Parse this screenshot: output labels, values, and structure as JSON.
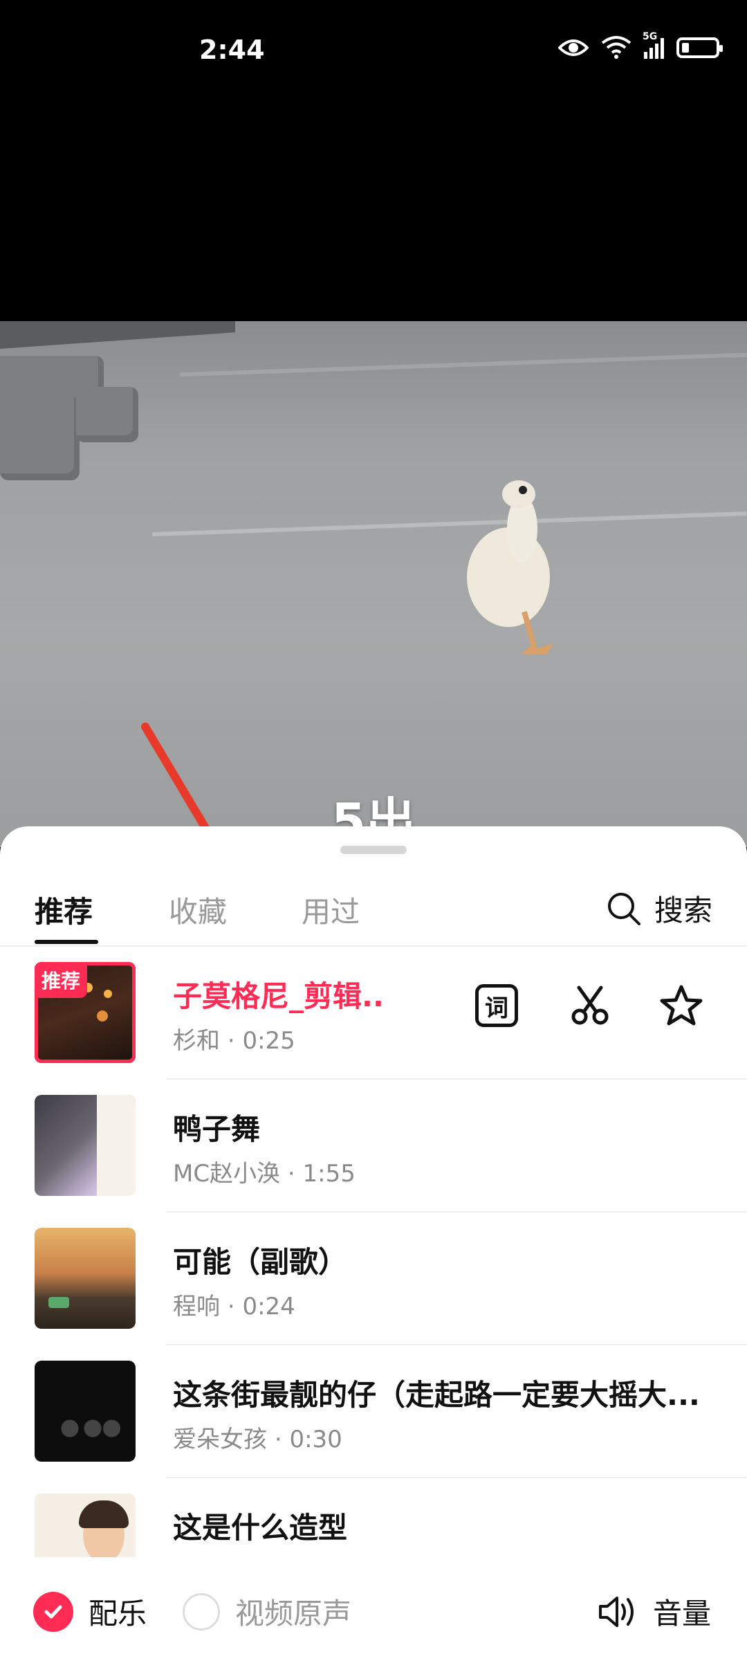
{
  "status_bar": {
    "time": "2:44",
    "network": "5G"
  },
  "video": {
    "caption": "5出"
  },
  "tabs": [
    {
      "label": "推荐"
    },
    {
      "label": "收藏"
    },
    {
      "label": "用过"
    }
  ],
  "search": {
    "label": "搜索"
  },
  "songs": [
    {
      "badge": "推荐",
      "title": "子莫格尼_剪辑..",
      "artist": "杉和",
      "duration": "0:25"
    },
    {
      "title": "鸭子舞",
      "artist": "MC赵小涣",
      "duration": "1:55"
    },
    {
      "title": "可能（副歌）",
      "artist": "程响",
      "duration": "0:24"
    },
    {
      "title": "这条街最靓的仔（走起路一定要大摇大...",
      "artist": "爱朵女孩",
      "duration": "0:30"
    },
    {
      "title": "这是什么造型",
      "artist": "",
      "duration": ""
    }
  ],
  "actions": {
    "lyrics_icon_text": "词"
  },
  "footer": {
    "music_label": "配乐",
    "original_label": "视频原声",
    "volume_label": "音量"
  },
  "colors": {
    "accent": "#fe2c55"
  }
}
